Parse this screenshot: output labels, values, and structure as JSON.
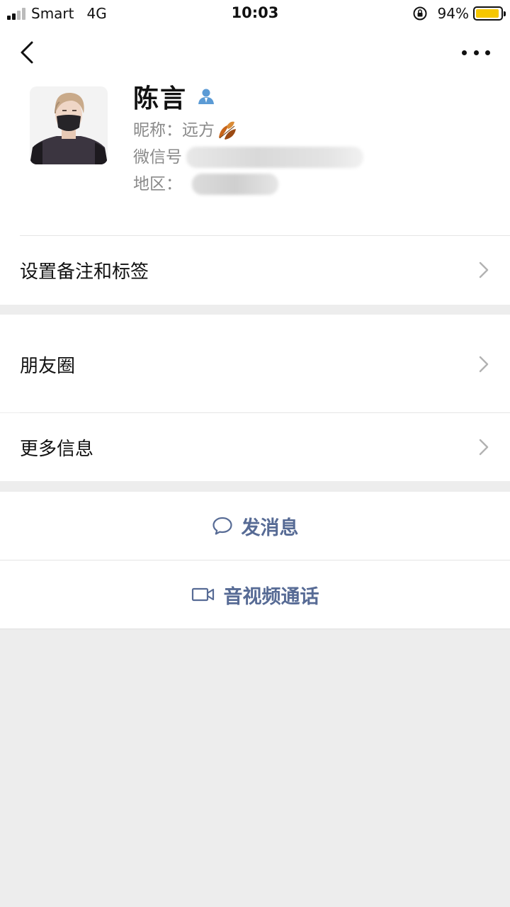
{
  "status_bar": {
    "carrier": "Smart",
    "network": "4G",
    "time": "10:03",
    "battery_percent": "94%",
    "battery_level": 0.94
  },
  "profile": {
    "name": "陈言",
    "nickname_label": "昵称：",
    "nickname": "远方",
    "wechat_id_label": "微信号",
    "region_label": "地区："
  },
  "rows": {
    "remark_tags": "设置备注和标签",
    "moments": "朋友圈",
    "more_info": "更多信息"
  },
  "actions": {
    "send_message": "发消息",
    "video_call": "音视频通话"
  },
  "colors": {
    "link_blue": "#576b95",
    "battery_yellow": "#f6c700",
    "page_background": "#ededed"
  },
  "icons": [
    "back-icon",
    "more-icon",
    "gender-icon",
    "leaf-icon",
    "chevron-right-icon",
    "chat-bubble-icon",
    "video-camera-icon"
  ]
}
